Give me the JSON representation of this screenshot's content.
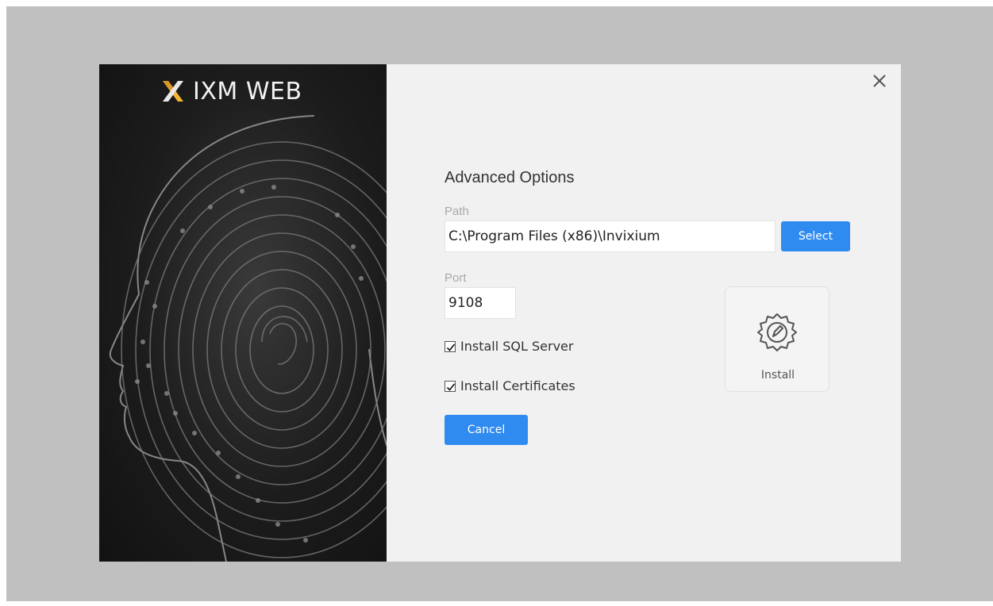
{
  "app": {
    "title": "IXM WEB"
  },
  "dialog": {
    "section_title": "Advanced Options",
    "path": {
      "label": "Path",
      "value": "C:\\Program Files (x86)\\Invixium",
      "select_label": "Select"
    },
    "port": {
      "label": "Port",
      "value": "9108"
    },
    "options": [
      {
        "label": "Install SQL Server",
        "checked": true
      },
      {
        "label": "Install Certificates",
        "checked": true
      }
    ],
    "cancel_label": "Cancel",
    "install_label": "Install"
  },
  "colors": {
    "accent": "#2f8bf0",
    "logo_mark_gold": "#f4b731",
    "logo_mark_light": "#e8e8e8"
  },
  "icons": {
    "close": "close-icon",
    "install": "gear-icon",
    "logo": "x-logo-icon"
  }
}
